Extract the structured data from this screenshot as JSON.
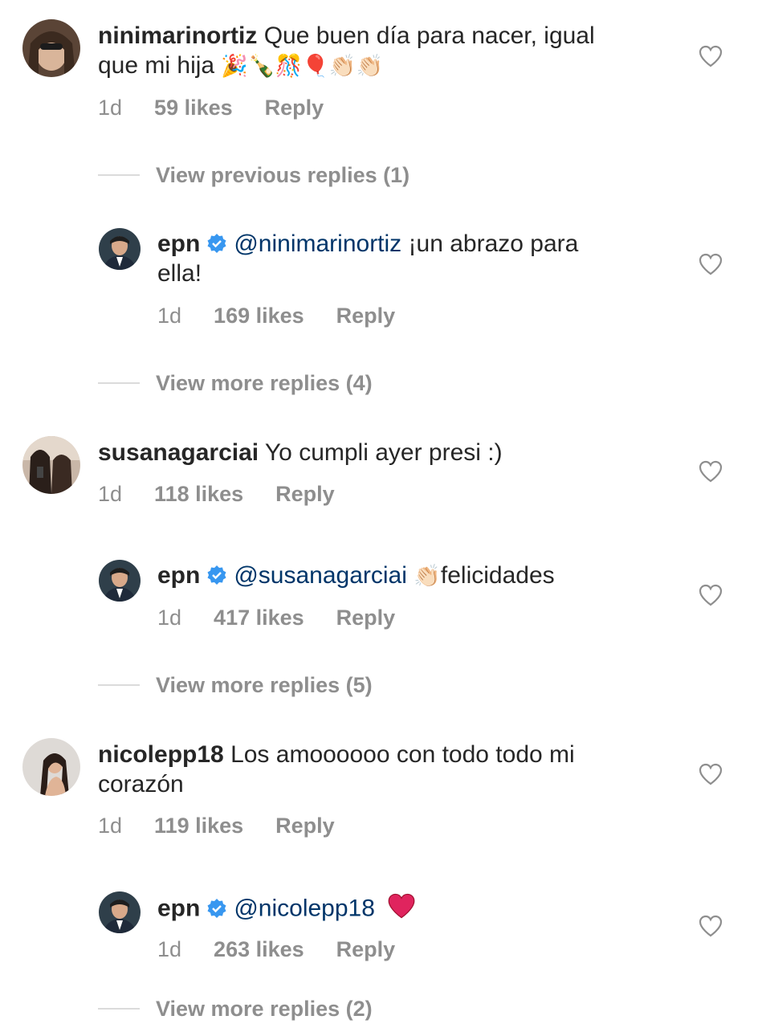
{
  "comments": [
    {
      "username": "ninimarinortiz",
      "text_line1": "Que buen día para nacer, igual",
      "text_line2": "que mi hija",
      "emojis": "🎉🍾🎊🎈👏🏻👏🏻",
      "time": "1d",
      "likes": "59 likes",
      "reply": "Reply",
      "view_replies": "View previous replies (1)",
      "reply_item": {
        "username": "epn",
        "mention": "@ninimarinortiz",
        "text_line1": "¡un abrazo para",
        "text_line2": "ella!",
        "time": "1d",
        "likes": "169 likes",
        "reply": "Reply"
      },
      "view_more": "View more replies (4)"
    },
    {
      "username": "susanagarciai",
      "text": "Yo cumpli ayer presi :)",
      "time": "1d",
      "likes": "118 likes",
      "reply": "Reply",
      "reply_item": {
        "username": "epn",
        "mention": "@susanagarciai",
        "emoji": "👏🏻",
        "text": "felicidades",
        "time": "1d",
        "likes": "417 likes",
        "reply": "Reply"
      },
      "view_more": "View more replies (5)"
    },
    {
      "username": "nicolepp18",
      "text_line1": "Los amoooooo con todo todo mi",
      "text_line2": "corazón",
      "time": "1d",
      "likes": "119 likes",
      "reply": "Reply",
      "reply_item": {
        "username": "epn",
        "mention": "@nicolepp18",
        "emoji": "❤️",
        "time": "1d",
        "likes": "263 likes",
        "reply": "Reply"
      },
      "view_more": "View more replies (2)"
    }
  ],
  "colors": {
    "text": "#262626",
    "muted": "#8e8e8e",
    "mention": "#003569",
    "verified": "#3897f0"
  },
  "icons": {
    "like": "heart-outline-icon",
    "verified": "verified-badge-icon"
  }
}
